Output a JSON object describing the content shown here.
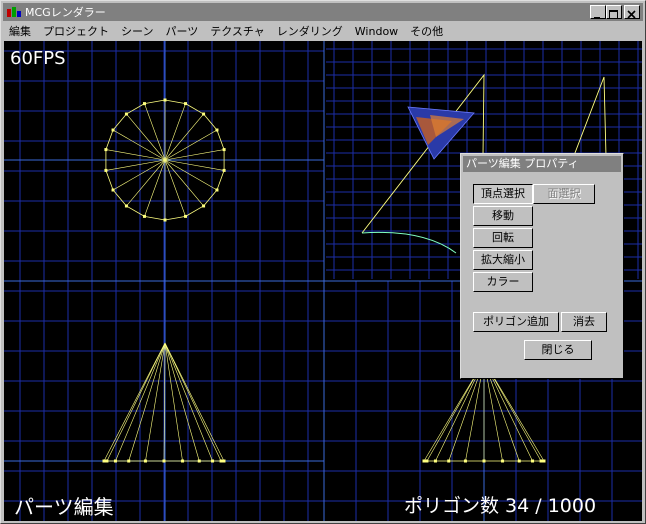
{
  "window": {
    "title": "MCGレンダラー"
  },
  "menu": [
    "編集",
    "プロジェクト",
    "シーン",
    "パーツ",
    "テクスチャ",
    "レンダリング",
    "Window",
    "その他"
  ],
  "viewport": {
    "fps": "60FPS",
    "mode": "パーツ編集",
    "polygon_count": "ポリゴン数 34 / 1000"
  },
  "dialog": {
    "title": "パーツ編集 プロパティ",
    "buttons": {
      "vertex_select": "頂点選択",
      "face_select": "面選択",
      "move": "移動",
      "rotate": "回転",
      "scale": "拡大縮小",
      "color": "カラー",
      "add_polygon": "ポリゴン追加",
      "delete": "消去",
      "close": "閉じる"
    }
  },
  "colors": {
    "grid": "#1c2ea8",
    "axis": "#3a6ad8",
    "wire": "#ffff80",
    "background": "#000000",
    "titlebar": "#808080"
  }
}
